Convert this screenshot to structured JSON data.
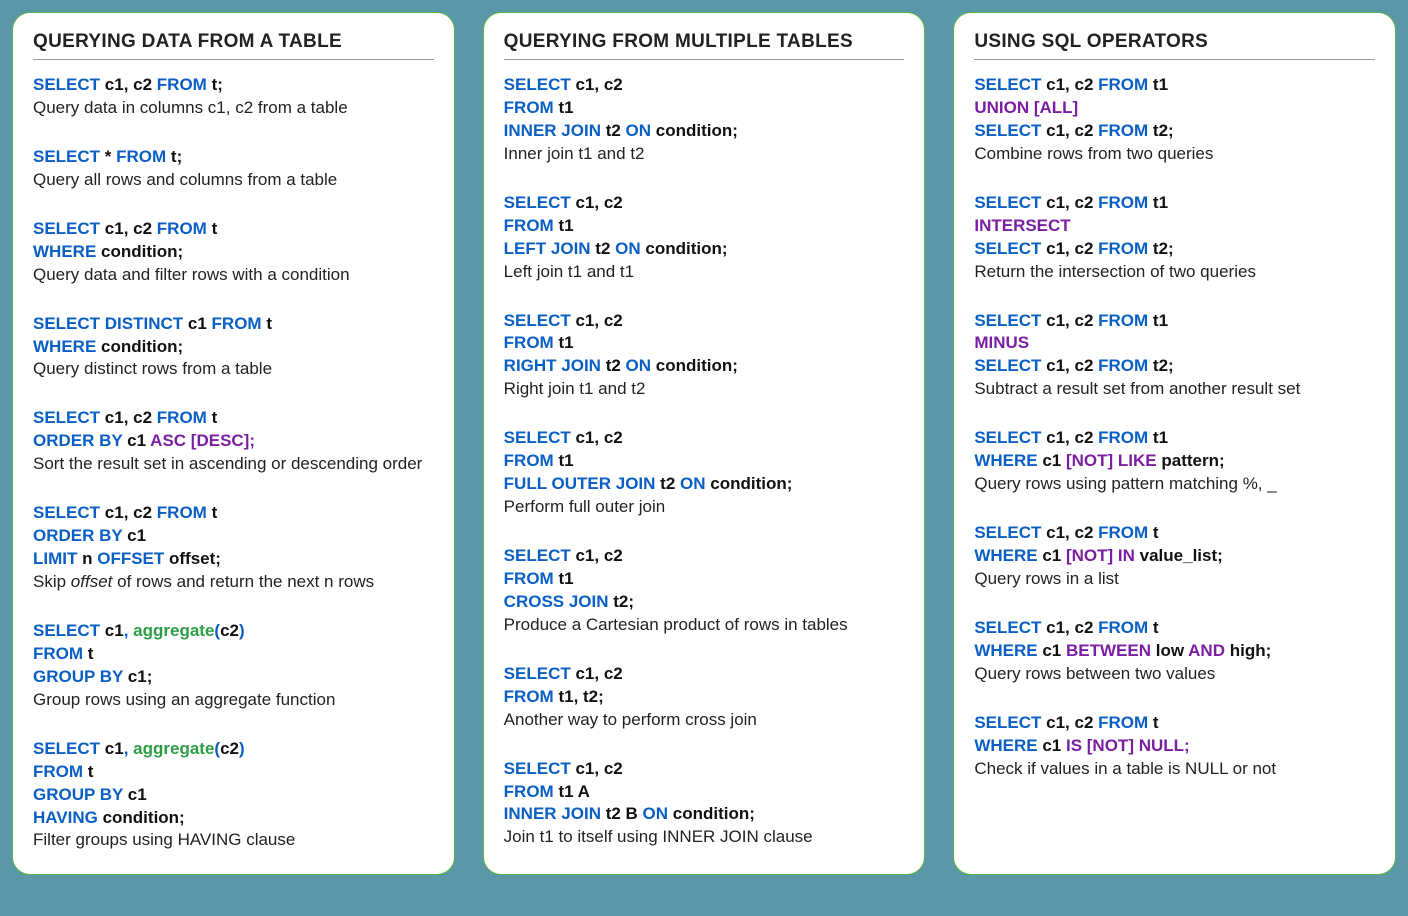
{
  "cards": [
    {
      "title": "QUERYING DATA FROM A TABLE",
      "blocks": [
        {
          "code": [
            [
              [
                "kw",
                "SELECT "
              ],
              [
                "id",
                "c1, c2 "
              ],
              [
                "kw",
                "FROM "
              ],
              [
                "id",
                "t;"
              ]
            ]
          ],
          "desc": "Query data in columns c1, c2 from a table"
        },
        {
          "code": [
            [
              [
                "kw",
                "SELECT "
              ],
              [
                "id",
                "* "
              ],
              [
                "kw",
                "FROM "
              ],
              [
                "id",
                "t;"
              ]
            ]
          ],
          "desc": "Query all rows and columns from a table"
        },
        {
          "code": [
            [
              [
                "kw",
                "SELECT "
              ],
              [
                "id",
                "c1, c2 "
              ],
              [
                "kw",
                "FROM "
              ],
              [
                "id",
                "t"
              ]
            ],
            [
              [
                "kw",
                "WHERE "
              ],
              [
                "id",
                "condition;"
              ]
            ]
          ],
          "desc": "Query data and filter rows with a condition"
        },
        {
          "code": [
            [
              [
                "kw",
                "SELECT DISTINCT "
              ],
              [
                "id",
                "c1 "
              ],
              [
                "kw",
                "FROM "
              ],
              [
                "id",
                "t"
              ]
            ],
            [
              [
                "kw",
                "WHERE "
              ],
              [
                "id",
                "condition;"
              ]
            ]
          ],
          "desc": "Query distinct rows from a table"
        },
        {
          "code": [
            [
              [
                "kw",
                "SELECT "
              ],
              [
                "id",
                "c1, c2 "
              ],
              [
                "kw",
                "FROM "
              ],
              [
                "id",
                "t"
              ]
            ],
            [
              [
                "kw",
                "ORDER BY "
              ],
              [
                "id",
                "c1 "
              ],
              [
                "pp",
                "ASC [DESC];"
              ]
            ]
          ],
          "desc": "Sort the result set in ascending or descending order"
        },
        {
          "code": [
            [
              [
                "kw",
                "SELECT "
              ],
              [
                "id",
                "c1, c2 "
              ],
              [
                "kw",
                "FROM "
              ],
              [
                "id",
                "t"
              ]
            ],
            [
              [
                "kw",
                "ORDER BY "
              ],
              [
                "id",
                "c1"
              ]
            ],
            [
              [
                "kw",
                "LIMIT "
              ],
              [
                "id",
                "n "
              ],
              [
                "kw",
                "OFFSET "
              ],
              [
                "id",
                "offset;"
              ]
            ]
          ],
          "desc": "Skip <i>offset</i> of rows and return the next n rows"
        },
        {
          "code": [
            [
              [
                "kw",
                "SELECT "
              ],
              [
                "id",
                "c1"
              ],
              [
                "kw",
                ", "
              ],
              [
                "fn",
                "aggregate"
              ],
              [
                "kw",
                "("
              ],
              [
                "id",
                "c2"
              ],
              [
                "kw",
                ")"
              ]
            ],
            [
              [
                "kw",
                "FROM "
              ],
              [
                "id",
                "t"
              ]
            ],
            [
              [
                "kw",
                "GROUP BY "
              ],
              [
                "id",
                "c1;"
              ]
            ]
          ],
          "desc": "Group rows using an aggregate function"
        },
        {
          "code": [
            [
              [
                "kw",
                "SELECT "
              ],
              [
                "id",
                "c1"
              ],
              [
                "kw",
                ", "
              ],
              [
                "fn",
                "aggregate"
              ],
              [
                "kw",
                "("
              ],
              [
                "id",
                "c2"
              ],
              [
                "kw",
                ")"
              ]
            ],
            [
              [
                "kw",
                "FROM "
              ],
              [
                "id",
                "t"
              ]
            ],
            [
              [
                "kw",
                "GROUP BY "
              ],
              [
                "id",
                "c1"
              ]
            ],
            [
              [
                "kw",
                "HAVING "
              ],
              [
                "id",
                "condition;"
              ]
            ]
          ],
          "desc": "Filter groups using HAVING clause"
        }
      ]
    },
    {
      "title": "QUERYING FROM MULTIPLE TABLES",
      "blocks": [
        {
          "code": [
            [
              [
                "kw",
                "SELECT "
              ],
              [
                "id",
                "c1, c2"
              ]
            ],
            [
              [
                "kw",
                "FROM "
              ],
              [
                "id",
                "t1"
              ]
            ],
            [
              [
                "kw",
                "INNER JOIN "
              ],
              [
                "id",
                "t2 "
              ],
              [
                "kw",
                "ON "
              ],
              [
                "id",
                "condition;"
              ]
            ]
          ],
          "desc": "Inner join t1 and t2"
        },
        {
          "code": [
            [
              [
                "kw",
                "SELECT "
              ],
              [
                "id",
                "c1, c2"
              ]
            ],
            [
              [
                "kw",
                "FROM "
              ],
              [
                "id",
                "t1"
              ]
            ],
            [
              [
                "kw",
                "LEFT JOIN "
              ],
              [
                "id",
                "t2 "
              ],
              [
                "kw",
                "ON "
              ],
              [
                "id",
                "condition;"
              ]
            ]
          ],
          "desc": "Left join t1 and t1"
        },
        {
          "code": [
            [
              [
                "kw",
                "SELECT "
              ],
              [
                "id",
                "c1, c2"
              ]
            ],
            [
              [
                "kw",
                "FROM "
              ],
              [
                "id",
                "t1"
              ]
            ],
            [
              [
                "kw",
                "RIGHT JOIN "
              ],
              [
                "id",
                "t2 "
              ],
              [
                "kw",
                "ON "
              ],
              [
                "id",
                "condition;"
              ]
            ]
          ],
          "desc": "Right join t1 and t2"
        },
        {
          "code": [
            [
              [
                "kw",
                "SELECT "
              ],
              [
                "id",
                "c1, c2"
              ]
            ],
            [
              [
                "kw",
                "FROM "
              ],
              [
                "id",
                "t1"
              ]
            ],
            [
              [
                "kw",
                "FULL OUTER JOIN "
              ],
              [
                "id",
                "t2 "
              ],
              [
                "kw",
                "ON "
              ],
              [
                "id",
                "condition;"
              ]
            ]
          ],
          "desc": "Perform full outer join"
        },
        {
          "code": [
            [
              [
                "kw",
                "SELECT "
              ],
              [
                "id",
                "c1, c2"
              ]
            ],
            [
              [
                "kw",
                "FROM "
              ],
              [
                "id",
                "t1"
              ]
            ],
            [
              [
                "kw",
                "CROSS JOIN "
              ],
              [
                "id",
                "t2;"
              ]
            ]
          ],
          "desc": "Produce a Cartesian product of rows in tables"
        },
        {
          "code": [
            [
              [
                "kw",
                "SELECT "
              ],
              [
                "id",
                "c1, c2"
              ]
            ],
            [
              [
                "kw",
                "FROM "
              ],
              [
                "id",
                "t1, t2"
              ],
              [
                "id",
                ";"
              ]
            ]
          ],
          "desc": "Another way to perform cross join"
        },
        {
          "code": [
            [
              [
                "kw",
                "SELECT "
              ],
              [
                "id",
                "c1, c2"
              ]
            ],
            [
              [
                "kw",
                "FROM "
              ],
              [
                "id",
                "t1 A"
              ]
            ],
            [
              [
                "kw",
                "INNER JOIN "
              ],
              [
                "id",
                "t2 B "
              ],
              [
                "kw",
                "ON "
              ],
              [
                "id",
                "condition;"
              ]
            ]
          ],
          "desc": "Join t1 to itself using INNER JOIN clause"
        }
      ]
    },
    {
      "title": "USING SQL OPERATORS",
      "blocks": [
        {
          "code": [
            [
              [
                "kw",
                "SELECT "
              ],
              [
                "id",
                "c1, c2 "
              ],
              [
                "kw",
                "FROM "
              ],
              [
                "id",
                "t1"
              ]
            ],
            [
              [
                "pp",
                "UNION [ALL]"
              ]
            ],
            [
              [
                "kw",
                "SELECT "
              ],
              [
                "id",
                "c1, c2 "
              ],
              [
                "kw",
                "FROM "
              ],
              [
                "id",
                "t2;"
              ]
            ]
          ],
          "desc": "Combine rows from two queries"
        },
        {
          "code": [
            [
              [
                "kw",
                "SELECT "
              ],
              [
                "id",
                "c1, c2 "
              ],
              [
                "kw",
                "FROM "
              ],
              [
                "id",
                "t1"
              ]
            ],
            [
              [
                "pp",
                "INTERSECT"
              ]
            ],
            [
              [
                "kw",
                "SELECT "
              ],
              [
                "id",
                "c1, c2 "
              ],
              [
                "kw",
                "FROM "
              ],
              [
                "id",
                "t2;"
              ]
            ]
          ],
          "desc": "Return the intersection of two queries"
        },
        {
          "code": [
            [
              [
                "kw",
                "SELECT "
              ],
              [
                "id",
                "c1, c2 "
              ],
              [
                "kw",
                "FROM "
              ],
              [
                "id",
                "t1"
              ]
            ],
            [
              [
                "pp",
                "MINUS"
              ]
            ],
            [
              [
                "kw",
                "SELECT "
              ],
              [
                "id",
                "c1, c2 "
              ],
              [
                "kw",
                "FROM "
              ],
              [
                "id",
                "t2;"
              ]
            ]
          ],
          "desc": "Subtract a result set from another result set"
        },
        {
          "code": [
            [
              [
                "kw",
                "SELECT "
              ],
              [
                "id",
                "c1, c2 "
              ],
              [
                "kw",
                "FROM "
              ],
              [
                "id",
                "t1"
              ]
            ],
            [
              [
                "kw",
                "WHERE "
              ],
              [
                "id",
                "c1 "
              ],
              [
                "pp",
                "[NOT] LIKE "
              ],
              [
                "id",
                "pattern;"
              ]
            ]
          ],
          "desc": "Query rows using pattern matching %, _"
        },
        {
          "code": [
            [
              [
                "kw",
                "SELECT "
              ],
              [
                "id",
                "c1, c2 "
              ],
              [
                "kw",
                "FROM "
              ],
              [
                "id",
                "t"
              ]
            ],
            [
              [
                "kw",
                "WHERE "
              ],
              [
                "id",
                "c1 "
              ],
              [
                "pp",
                "[NOT] IN "
              ],
              [
                "id",
                "value_list;"
              ]
            ]
          ],
          "desc": "Query rows in a list"
        },
        {
          "code": [
            [
              [
                "kw",
                "SELECT "
              ],
              [
                "id",
                "c1, c2 "
              ],
              [
                "kw",
                "FROM "
              ],
              [
                "id",
                "t"
              ]
            ],
            [
              [
                "kw",
                "WHERE  "
              ],
              [
                "id",
                "c1 "
              ],
              [
                "pp",
                "BETWEEN "
              ],
              [
                "id",
                "low "
              ],
              [
                "pp",
                "AND "
              ],
              [
                "id",
                "high;"
              ]
            ]
          ],
          "desc": "Query rows between two values"
        },
        {
          "code": [
            [
              [
                "kw",
                "SELECT "
              ],
              [
                "id",
                "c1, c2 "
              ],
              [
                "kw",
                "FROM "
              ],
              [
                "id",
                "t"
              ]
            ],
            [
              [
                "kw",
                "WHERE  "
              ],
              [
                "id",
                "c1 "
              ],
              [
                "pp",
                "IS [NOT] NULL;"
              ]
            ]
          ],
          "desc": "Check if values in a table is NULL or not"
        }
      ]
    }
  ]
}
